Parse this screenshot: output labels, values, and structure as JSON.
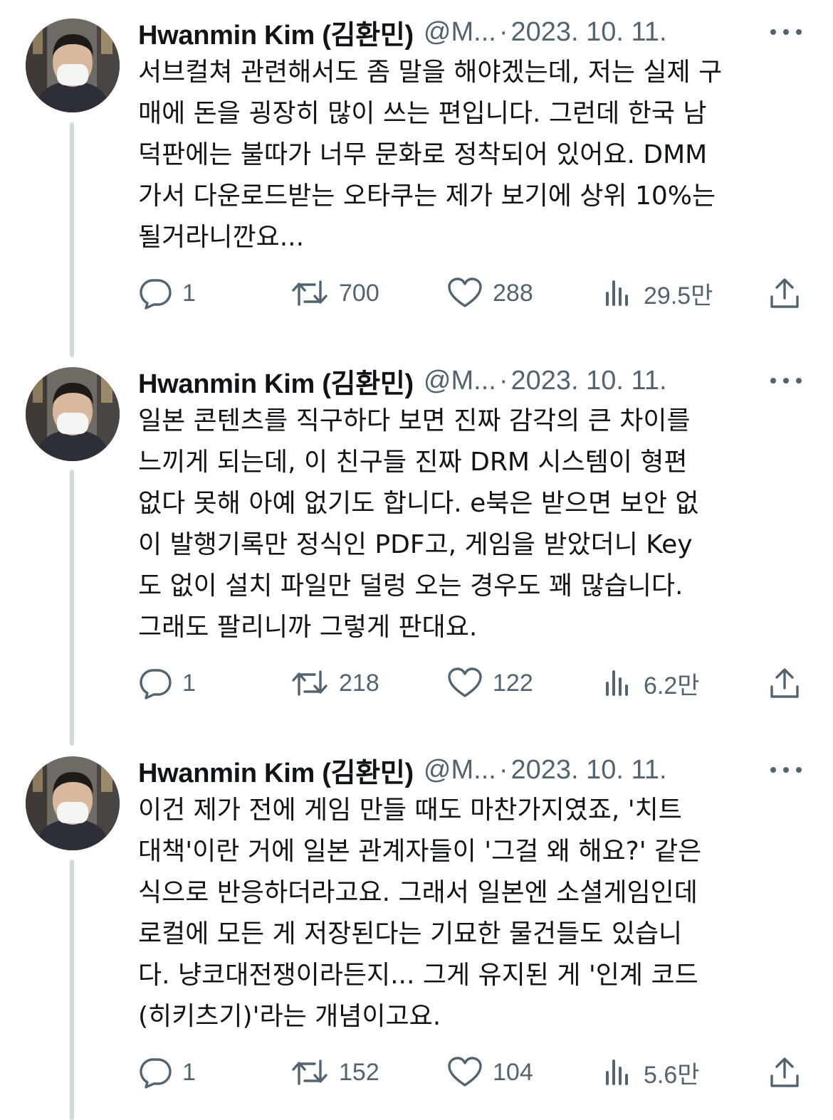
{
  "tweets": [
    {
      "author": "Hwanmin Kim (김환민)",
      "handle": "@M...",
      "separator": "·",
      "date": "2023. 10. 11.",
      "lines": [
        "서브컬쳐 관련해서도 좀 말을 해야겠는데, 저는 실제 구",
        "매에 돈을 굉장히 많이 쓰는 편입니다. 그런데 한국 남",
        "덕판에는 불따가 너무 문화로 정착되어 있어요. DMM",
        "가서 다운로드받는 오타쿠는 제가 보기에 상위 10%는",
        "될거라니깐요..."
      ],
      "replies": "1",
      "retweets": "700",
      "likes": "288",
      "views": "29.5만"
    },
    {
      "author": "Hwanmin Kim (김환민)",
      "handle": "@M...",
      "separator": "·",
      "date": "2023. 10. 11.",
      "lines": [
        "일본 콘텐츠를 직구하다 보면 진짜 감각의 큰 차이를",
        "느끼게 되는데, 이 친구들 진짜 DRM 시스템이 형편",
        "없다 못해 아예 없기도 합니다. e북은 받으면 보안 없",
        "이 발행기록만 정식인 PDF고, 게임을 받았더니 Key",
        "도 없이 설치 파일만 덜렁 오는 경우도 꽤 많습니다.",
        "그래도 팔리니까 그렇게 판대요."
      ],
      "replies": "1",
      "retweets": "218",
      "likes": "122",
      "views": "6.2만"
    },
    {
      "author": "Hwanmin Kim (김환민)",
      "handle": "@M...",
      "separator": "·",
      "date": "2023. 10. 11.",
      "lines": [
        "이건 제가 전에 게임 만들 때도 마찬가지였죠, '치트",
        "대책'이란 거에 일본 관계자들이 '그걸 왜 해요?' 같은",
        "식으로 반응하더라고요. 그래서 일본엔 소셜게임인데",
        "로컬에 모든 게 저장된다는 기묘한 물건들도 있습니",
        "다. 냥코대전쟁이라든지... 그게 유지된 게 '인계 코드",
        "(히키츠기)'라는 개념이고요."
      ],
      "replies": "1",
      "retweets": "152",
      "likes": "104",
      "views": "5.6만"
    }
  ],
  "icons": {
    "reply": "reply-icon",
    "retweet": "retweet-icon",
    "like": "heart-icon",
    "views": "views-icon",
    "share": "share-icon",
    "more": "more-icon"
  },
  "colors": {
    "text": "#0f1419",
    "secondary": "#536471",
    "thread_line": "#cfd9de"
  }
}
